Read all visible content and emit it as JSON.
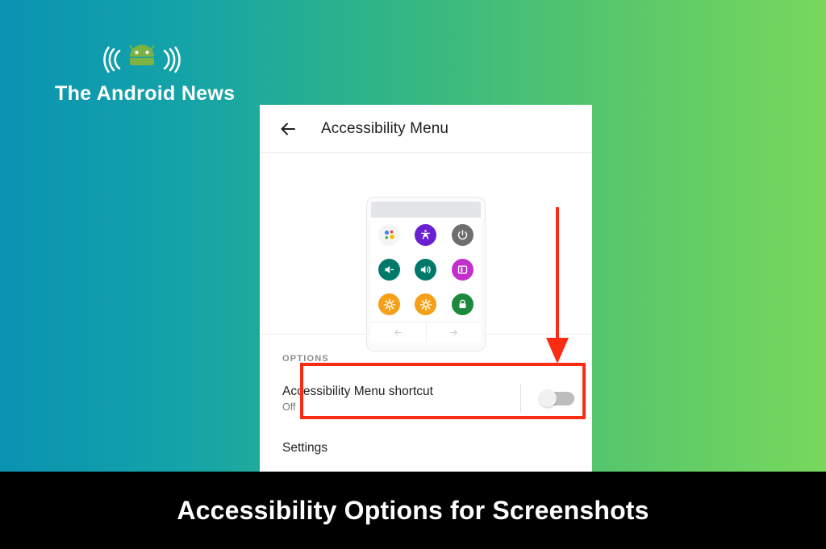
{
  "brand": {
    "name": "The Android News",
    "logo_icon": "android-robot-with-signal-waves-icon",
    "robot_color": "#7cb342"
  },
  "colors": {
    "gradient_left": "#0a93b3",
    "gradient_right": "#78d85c",
    "annotation_red": "#fc2b13",
    "caption_bar": "#000000"
  },
  "card": {
    "header": {
      "back_icon": "back-arrow-icon",
      "title": "Accessibility Menu"
    },
    "preview": {
      "device_icon_rows": [
        [
          {
            "name": "google-assistant-icon",
            "color": "#f5f5f5",
            "glyph": "assistant"
          },
          {
            "name": "accessibility-person-icon",
            "color": "#6a1fd0",
            "glyph": "person"
          },
          {
            "name": "power-icon",
            "color": "#6e6e6e",
            "glyph": "power"
          }
        ],
        [
          {
            "name": "volume-down-icon",
            "color": "#00796b",
            "glyph": "volume-down"
          },
          {
            "name": "volume-up-icon",
            "color": "#00796b",
            "glyph": "volume-up"
          },
          {
            "name": "recent-apps-icon",
            "color": "#c42ecb",
            "glyph": "recents"
          }
        ],
        [
          {
            "name": "brightness-down-icon",
            "color": "#f4a019",
            "glyph": "brightness"
          },
          {
            "name": "brightness-up-icon",
            "color": "#f4a019",
            "glyph": "brightness"
          },
          {
            "name": "lock-screen-icon",
            "color": "#1b8a3e",
            "glyph": "lock"
          }
        ]
      ],
      "nav_back_icon": "nav-back-arrow-icon",
      "nav_forward_icon": "nav-forward-arrow-icon"
    },
    "options": {
      "section_label": "OPTIONS",
      "shortcut_row": {
        "title": "Accessibility Menu shortcut",
        "subtitle": "Off",
        "toggle_state": "off"
      },
      "settings_row": {
        "title": "Settings"
      }
    }
  },
  "annotations": {
    "arrow_icon": "down-arrow-annotation-icon",
    "highlight_box": "red-highlight-box"
  },
  "caption": {
    "text": "Accessibility Options for Screenshots"
  }
}
